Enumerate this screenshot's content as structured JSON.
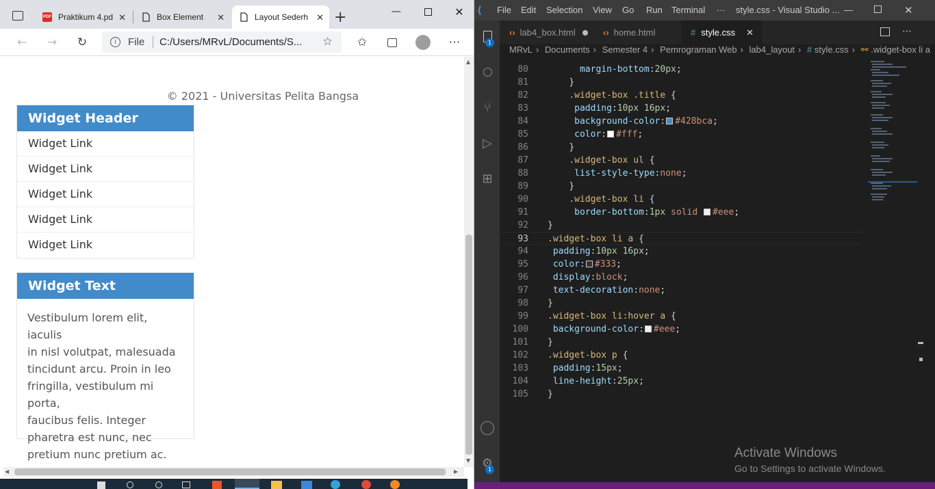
{
  "browser": {
    "tabs": [
      {
        "label": "Praktikum 4.pd",
        "icon": "pdf-icon"
      },
      {
        "label": "Box Element",
        "icon": "page-icon"
      },
      {
        "label": "Layout Sederh",
        "icon": "page-icon"
      }
    ],
    "url_scheme": "File",
    "url": "C:/Users/MRvL/Documents/S...",
    "page": {
      "footer": "© 2021 - Universitas Pelita Bangsa",
      "widget_header": "Widget Header",
      "widget_links": [
        "Widget Link",
        "Widget Link",
        "Widget Link",
        "Widget Link",
        "Widget Link"
      ],
      "widget_text_title": "Widget Text",
      "widget_text_lines": [
        "Vestibulum lorem elit, iaculis",
        "in nisl volutpat, malesuada",
        "tincidunt arcu. Proin in leo",
        "fringilla, vestibulum mi porta,",
        "faucibus felis. Integer",
        "pharetra est nunc, nec",
        "pretium nunc pretium ac."
      ]
    }
  },
  "vscode": {
    "menu": [
      "File",
      "Edit",
      "Selection",
      "View",
      "Go",
      "Run",
      "Terminal",
      "···"
    ],
    "window_title": "style.css - Visual Studio ...",
    "editor_tabs": [
      {
        "label": "lab4_box.html",
        "modified": true
      },
      {
        "label": "home.html",
        "modified": false
      },
      {
        "label": "style.css",
        "active": true
      }
    ],
    "breadcrumb": [
      "MRvL",
      "Documents",
      "Semester 4",
      "Pemrograman Web",
      "lab4_layout",
      "style.css",
      ".widget-box li a"
    ],
    "explorer_badge": "1",
    "accounts_badge": "1",
    "code": [
      {
        "n": "80",
        "parts": [
          [
            "prop",
            "margin-bottom"
          ],
          [
            "pun",
            ":"
          ],
          [
            "num",
            "20px"
          ],
          [
            "pun",
            ";"
          ]
        ],
        "indent": "      "
      },
      {
        "n": "81",
        "parts": [
          [
            "pun",
            "}"
          ]
        ],
        "indent": "    "
      },
      {
        "n": "82",
        "parts": [
          [
            "sel",
            ".widget-box .title"
          ],
          [
            "pun",
            " {"
          ]
        ],
        "indent": "    "
      },
      {
        "n": "83",
        "parts": [
          [
            "prop",
            "padding"
          ],
          [
            "pun",
            ":"
          ],
          [
            "num",
            "10px 16px"
          ],
          [
            "pun",
            ";"
          ]
        ],
        "indent": "     "
      },
      {
        "n": "84",
        "parts": [
          [
            "prop",
            "background-color"
          ],
          [
            "pun",
            ":"
          ],
          [
            "sw",
            "#428bca"
          ],
          [
            "val",
            "#428bca"
          ],
          [
            "pun",
            ";"
          ]
        ],
        "indent": "     "
      },
      {
        "n": "85",
        "parts": [
          [
            "prop",
            "color"
          ],
          [
            "pun",
            ":"
          ],
          [
            "sw",
            "#fff"
          ],
          [
            "val",
            "#fff"
          ],
          [
            "pun",
            ";"
          ]
        ],
        "indent": "     "
      },
      {
        "n": "86",
        "parts": [
          [
            "pun",
            "}"
          ]
        ],
        "indent": "    "
      },
      {
        "n": "87",
        "parts": [
          [
            "sel",
            ".widget-box ul"
          ],
          [
            "pun",
            " {"
          ]
        ],
        "indent": "    "
      },
      {
        "n": "88",
        "parts": [
          [
            "prop",
            "list-style-type"
          ],
          [
            "pun",
            ":"
          ],
          [
            "val",
            "none"
          ],
          [
            "pun",
            ";"
          ]
        ],
        "indent": "     "
      },
      {
        "n": "89",
        "parts": [
          [
            "pun",
            "}"
          ]
        ],
        "indent": "    "
      },
      {
        "n": "90",
        "parts": [
          [
            "sel",
            ".widget-box li"
          ],
          [
            "pun",
            " {"
          ]
        ],
        "indent": "    "
      },
      {
        "n": "91",
        "parts": [
          [
            "prop",
            "border-bottom"
          ],
          [
            "pun",
            ":"
          ],
          [
            "num",
            "1px"
          ],
          [
            "val",
            " solid "
          ],
          [
            "sw",
            "#eee"
          ],
          [
            "val",
            "#eee"
          ],
          [
            "pun",
            ";"
          ]
        ],
        "indent": "     "
      },
      {
        "n": "92",
        "parts": [
          [
            "pun",
            "}"
          ]
        ],
        "indent": ""
      },
      {
        "n": "93",
        "parts": [
          [
            "sel",
            ".widget-box li a"
          ],
          [
            "pun",
            " {"
          ]
        ],
        "indent": "",
        "current": true
      },
      {
        "n": "94",
        "parts": [
          [
            "prop",
            "padding"
          ],
          [
            "pun",
            ":"
          ],
          [
            "num",
            "10px 16px"
          ],
          [
            "pun",
            ";"
          ]
        ],
        "indent": " "
      },
      {
        "n": "95",
        "parts": [
          [
            "prop",
            "color"
          ],
          [
            "pun",
            ":"
          ],
          [
            "sw",
            "#333"
          ],
          [
            "val",
            "#333"
          ],
          [
            "pun",
            ";"
          ]
        ],
        "indent": " "
      },
      {
        "n": "96",
        "parts": [
          [
            "prop",
            "display"
          ],
          [
            "pun",
            ":"
          ],
          [
            "val",
            "block"
          ],
          [
            "pun",
            ";"
          ]
        ],
        "indent": " "
      },
      {
        "n": "97",
        "parts": [
          [
            "prop",
            "text-decoration"
          ],
          [
            "pun",
            ":"
          ],
          [
            "val",
            "none"
          ],
          [
            "pun",
            ";"
          ]
        ],
        "indent": " "
      },
      {
        "n": "98",
        "parts": [
          [
            "pun",
            "}"
          ]
        ],
        "indent": ""
      },
      {
        "n": "99",
        "parts": [
          [
            "sel",
            ".widget-box li:hover a"
          ],
          [
            "pun",
            " {"
          ]
        ],
        "indent": ""
      },
      {
        "n": "100",
        "parts": [
          [
            "prop",
            "background-color"
          ],
          [
            "pun",
            ":"
          ],
          [
            "sw",
            "#eee"
          ],
          [
            "val",
            "#eee"
          ],
          [
            "pun",
            ";"
          ]
        ],
        "indent": " "
      },
      {
        "n": "101",
        "parts": [
          [
            "pun",
            "}"
          ]
        ],
        "indent": ""
      },
      {
        "n": "102",
        "parts": [
          [
            "sel",
            ".widget-box p"
          ],
          [
            "pun",
            " {"
          ]
        ],
        "indent": ""
      },
      {
        "n": "103",
        "parts": [
          [
            "prop",
            "padding"
          ],
          [
            "pun",
            ":"
          ],
          [
            "num",
            "15px"
          ],
          [
            "pun",
            ";"
          ]
        ],
        "indent": " "
      },
      {
        "n": "104",
        "parts": [
          [
            "prop",
            "line-height"
          ],
          [
            "pun",
            ":"
          ],
          [
            "num",
            "25px"
          ],
          [
            "pun",
            ";"
          ]
        ],
        "indent": " "
      },
      {
        "n": "105",
        "parts": [
          [
            "pun",
            "}"
          ]
        ],
        "indent": ""
      }
    ],
    "watermark_title": "Activate Windows",
    "watermark_sub": "Go to Settings to activate Windows."
  },
  "colors": {
    "widget_blue": "#428bca",
    "vscode_status": "#68217a"
  }
}
